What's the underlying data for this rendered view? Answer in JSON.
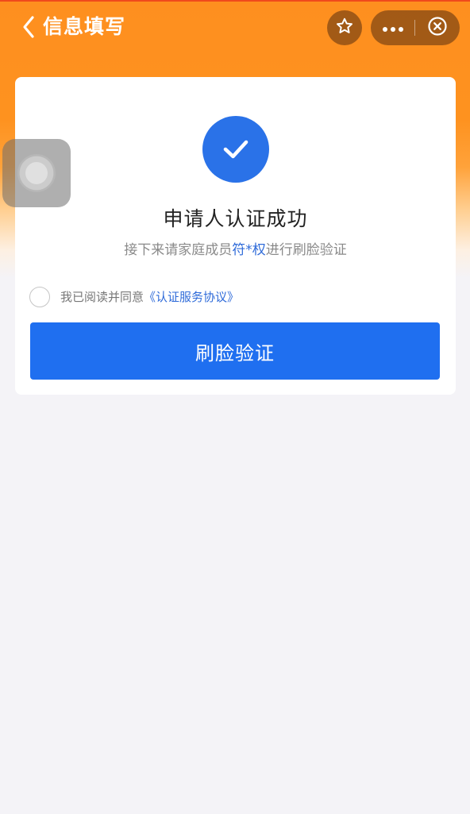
{
  "navbar": {
    "title": "信息填写",
    "back_icon": "chevron-left-icon",
    "favorite_icon": "star-icon",
    "more_icon": "more-dots-icon",
    "close_icon": "close-circle-icon"
  },
  "card": {
    "status_icon": "check-circle-icon",
    "title": "申请人认证成功",
    "subtitle_prefix": "接下来请家庭成员",
    "subtitle_name": "符*权",
    "subtitle_suffix": "进行刷脸验证",
    "agree_text": "我已阅读并同意",
    "agree_link": "《认证服务协议》",
    "agree_checked": false,
    "button_label": "刷脸验证"
  },
  "floating_ball": {
    "icon": "assistive-touch-icon"
  },
  "colors": {
    "header_orange": "#fe8f1f",
    "primary_blue": "#1f6ff0",
    "link_blue": "#2f6bd9",
    "page_background": "#f4f3f7"
  }
}
